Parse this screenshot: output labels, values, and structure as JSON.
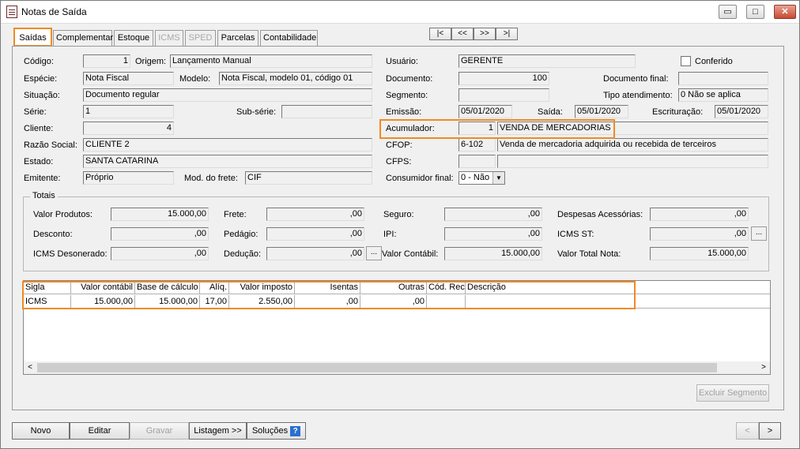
{
  "window": {
    "title": "Notas de Saída",
    "min": "▭",
    "max": "□",
    "close": "✕"
  },
  "tabs": [
    "Saídas",
    "Complementar",
    "Estoque",
    "ICMS",
    "SPED",
    "Parcelas",
    "Contabilidade"
  ],
  "nav": {
    "first": "|<",
    "prev": "<<",
    "next": ">>",
    "last": ">|"
  },
  "labels": {
    "codigo": "Código:",
    "origem": "Origem:",
    "especie": "Espécie:",
    "modelo": "Modelo:",
    "situacao": "Situação:",
    "serie": "Série:",
    "subserie": "Sub-série:",
    "cliente": "Cliente:",
    "razao": "Razão Social:",
    "estado": "Estado:",
    "emitente": "Emitente:",
    "modfrete": "Mod. do frete:",
    "usuario": "Usuário:",
    "conferido": "Conferido",
    "documento": "Documento:",
    "docfinal": "Documento final:",
    "segmento": "Segmento:",
    "tipoatend": "Tipo atendimento:",
    "emissao": "Emissão:",
    "saida": "Saída:",
    "escrituracao": "Escrituração:",
    "acumulador": "Acumulador:",
    "cfop": "CFOP:",
    "cfps": "CFPS:",
    "consumidor": "Consumidor final:"
  },
  "values": {
    "codigo": "1",
    "origem": "Lançamento Manual",
    "especie": "Nota Fiscal",
    "modelo": "Nota Fiscal, modelo 01, código 01",
    "situacao": "Documento regular",
    "serie": "1",
    "subserie": "",
    "cliente": "4",
    "razao": "CLIENTE 2",
    "estado": "SANTA CATARINA",
    "emitente": "Próprio",
    "modfrete": "CIF",
    "usuario": "GERENTE",
    "documento": "100",
    "docfinal": "",
    "segmento": "",
    "tipoatend": "0 Não se aplica",
    "emissao": "05/01/2020",
    "saida": "05/01/2020",
    "escrituracao": "05/01/2020",
    "acumulador_cod": "1",
    "acumulador_desc": "VENDA DE MERCADORIAS",
    "cfop_cod": "6-102",
    "cfop_desc": "Venda de mercadoria adquirida ou recebida de terceiros",
    "cfps_cod": "",
    "cfps_desc": "",
    "consumidor": "0 - Não"
  },
  "totais": {
    "title": "Totais",
    "valor_produtos_label": "Valor Produtos:",
    "valor_produtos": "15.000,00",
    "frete_label": "Frete:",
    "frete": ",00",
    "seguro_label": "Seguro:",
    "seguro": ",00",
    "despesas_label": "Despesas Acessórias:",
    "despesas": ",00",
    "desconto_label": "Desconto:",
    "desconto": ",00",
    "pedagio_label": "Pedágio:",
    "pedagio": ",00",
    "ipi_label": "IPI:",
    "ipi": ",00",
    "icmsst_label": "ICMS ST:",
    "icmsst": ",00",
    "icmsdes_label": "ICMS Desonerado:",
    "icmsdes": ",00",
    "deducao_label": "Dedução:",
    "deducao": ",00",
    "valorcontabil_label": "Valor Contábil:",
    "valorcontabil": "15.000,00",
    "valortotal_label": "Valor Total Nota:",
    "valortotal": "15.000,00"
  },
  "grid": {
    "headers": [
      "Sigla",
      "Valor contábil",
      "Base de cálculo",
      "Alíq.",
      "Valor imposto",
      "Isentas",
      "Outras",
      "Cód. Rec.",
      "Descrição"
    ],
    "rows": [
      [
        "ICMS",
        "15.000,00",
        "15.000,00",
        "17,00",
        "2.550,00",
        ",00",
        ",00",
        "",
        ""
      ]
    ]
  },
  "buttons": {
    "excluir": "Excluir Segmento",
    "novo": "Novo",
    "editar": "Editar",
    "gravar": "Gravar",
    "listagem": "Listagem >>",
    "solucoes": "Soluções",
    "help": "?",
    "prev": "<",
    "next": ">",
    "dots": "..."
  }
}
